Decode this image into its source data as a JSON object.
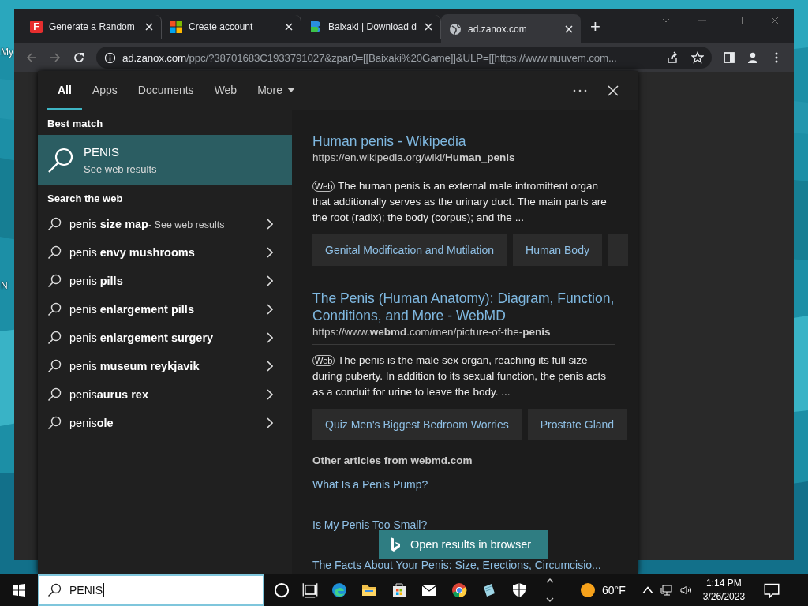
{
  "desktop": {
    "icon_labels": [
      "My",
      "N"
    ]
  },
  "browser": {
    "tabs": [
      {
        "title": "Generate a Random",
        "letter": "F",
        "selected": false
      },
      {
        "title": "Create account",
        "selected": false
      },
      {
        "title": "Baixaki | Download d",
        "selected": false
      },
      {
        "title": "ad.zanox.com",
        "selected": true
      }
    ],
    "new_tab": "+",
    "address": {
      "host": "ad.zanox.com",
      "path": "/ppc/?38701683C1933791027&zpar0=[[Baixaki%20Game]]&ULP=[[https://www.nuuvem.com..."
    }
  },
  "search_panel": {
    "filters": [
      {
        "label": "All",
        "selected": true
      },
      {
        "label": "Apps",
        "selected": false
      },
      {
        "label": "Documents",
        "selected": false
      },
      {
        "label": "Web",
        "selected": false
      }
    ],
    "more": "More",
    "best_match_heading": "Best match",
    "best_match": {
      "title": "PENIS",
      "subtitle": "See web results"
    },
    "web_heading": "Search the web",
    "suggestions": [
      {
        "text": "penis **size map**",
        "hint": "- See web results"
      },
      {
        "text": "penis **envy mushrooms**"
      },
      {
        "text": "penis **pills**"
      },
      {
        "text": "penis **enlargement pills**"
      },
      {
        "text": "penis **enlargement surgery**"
      },
      {
        "text": "penis **museum reykjavik**"
      },
      {
        "text": "penis**aurus rex**"
      },
      {
        "text": "penis**ole**"
      }
    ],
    "results": [
      {
        "title": "Human penis - Wikipedia",
        "url": "https://en.wikipedia.org/wiki/**Human_penis**",
        "source": "Web",
        "snippet": "The human penis is an external male intromittent organ that additionally serves as the urinary duct. The main parts are the root (radix); the body (corpus); and the ...",
        "chips": [
          "Genital Modification and Mutilation",
          "Human Body"
        ],
        "chips_cut": true
      },
      {
        "title": "The Penis (Human Anatomy): Diagram, Function, Conditions, and More - WebMD",
        "url": "https://www.**webmd**.com/men/picture-of-the-**penis**",
        "source": "Web",
        "snippet": "The penis is the male sex organ, reaching its full size during puberty. In addition to its sexual function, the penis acts as a conduit for urine to leave the body. ...",
        "chips": [
          "Quiz Men's Biggest Bedroom Worries",
          "Prostate Gland"
        ],
        "chips_cut": false
      }
    ],
    "other_heading": "Other articles from webmd.com",
    "articles": [
      "What Is a Penis Pump?",
      "Is My Penis Too Small?",
      "The Facts About Your Penis: Size, Erections, Circumcisio..."
    ],
    "open_button": "Open results in browser"
  },
  "taskbar": {
    "search_value": "PENIS",
    "weather": "60°F",
    "time": "1:14 PM",
    "date": "3/26/2023"
  }
}
